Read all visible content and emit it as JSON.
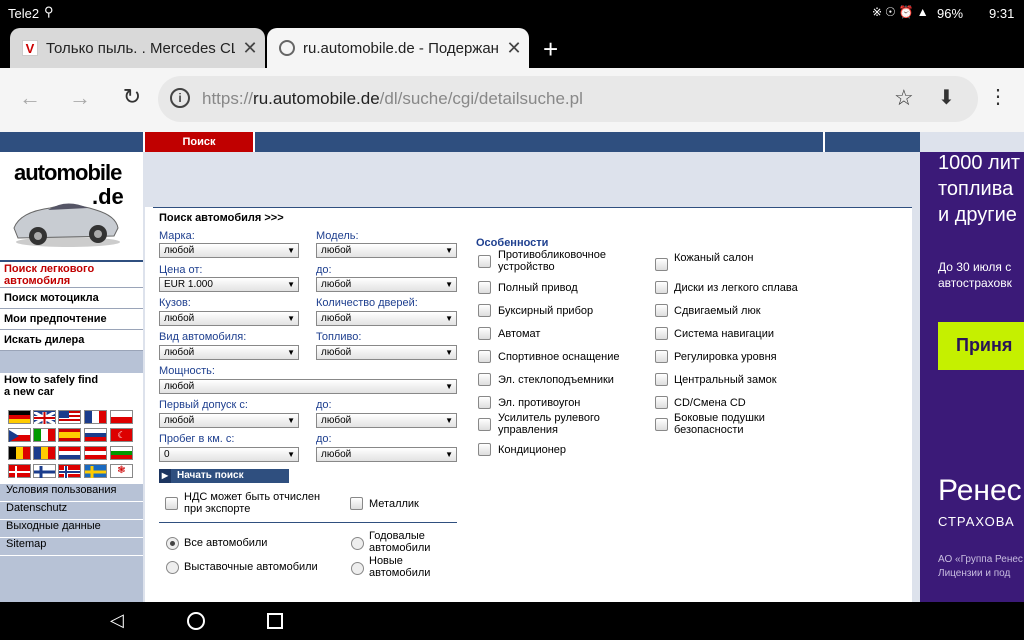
{
  "status": {
    "carrier": "Tele2",
    "battery": "96%",
    "time": "9:31"
  },
  "tabs": [
    {
      "favicon": "V",
      "title": "Только пыль. . Mercedes CLK"
    },
    {
      "title": "ru.automobile.de - Подержанн"
    }
  ],
  "url": {
    "prefix": "https://",
    "domain": "ru.automobile.de",
    "path": "/dl/suche/cgi/detailsuche.pl"
  },
  "topnav": {
    "search": "Поиск"
  },
  "logo": {
    "line1": "automobile",
    "line2": ".de"
  },
  "left_nav": [
    "Поиск легкового автомобиля",
    "Поиск мотоцикла",
    "Мои предпочтение",
    "Искать дилера"
  ],
  "howto": "How to safely find a new car",
  "footer_links": [
    "Условия пользования",
    "Datenschutz",
    "Выходные данные",
    "Sitemap"
  ],
  "form": {
    "title": "Поиск автомобиля >>>",
    "marka_label": "Марка:",
    "marka_value": "любой",
    "model_label": "Модель:",
    "model_value": "любой",
    "price_from_label": "Цена от:",
    "price_from_value": "EUR 1.000",
    "price_to_label": "до:",
    "price_to_value": "любой",
    "body_label": "Кузов:",
    "body_value": "любой",
    "doors_label": "Количество дверей:",
    "doors_value": "любой",
    "type_label": "Вид автомобиля:",
    "type_value": "любой",
    "fuel_label": "Топливо:",
    "fuel_value": "любой",
    "power_label": "Мощность:",
    "power_value": "любой",
    "reg_from_label": "Первый допуск с:",
    "reg_from_value": "любой",
    "reg_to_label": "до:",
    "reg_to_value": "любой",
    "km_from_label": "Пробег в км. с:",
    "km_from_value": "0",
    "km_to_label": "до:",
    "km_to_value": "любой",
    "search_button": "Начать поиск",
    "vat_label": "НДС может быть отчислен при экспорте",
    "metallic_label": "Металлик",
    "radio_all": "Все автомобили",
    "radio_yearly": "Годовалые автомобили",
    "radio_show": "Выставочные автомобили",
    "radio_new": "Новые автомобили"
  },
  "features": {
    "title": "Особенности",
    "col1": [
      "Противобликовочное устройство",
      "Полный привод",
      "Буксирный прибор",
      "Автомат",
      "Спортивное оснащение",
      "Эл. стеклоподъемники",
      "Эл. противоугон",
      "Усилитель рулевого управления",
      "Кондиционер"
    ],
    "col2": [
      "Кожаный салон",
      "Диски из легкого сплава",
      "Сдвигаемый люк",
      "Система навигации",
      "Регулировка уровня",
      "Центральный замок",
      "CD/Смена CD",
      "Боковые подушки безопасности"
    ]
  },
  "ad": {
    "line1": "1000 лит",
    "line2": "топлива",
    "line3": "и другие",
    "small1": "До 30 июля с",
    "small2": "автостраховк",
    "button": "Приня",
    "brand": "Ренес",
    "brand_sub": "СТРАХОВА",
    "legal1": "АО «Группа Ренес",
    "legal2": "Лицензии и под"
  },
  "colors": {
    "nav_blue": "#2f4f7f",
    "accent_red": "#c00000",
    "ad_purple": "#3b1a78",
    "ad_button": "#c5f000"
  }
}
